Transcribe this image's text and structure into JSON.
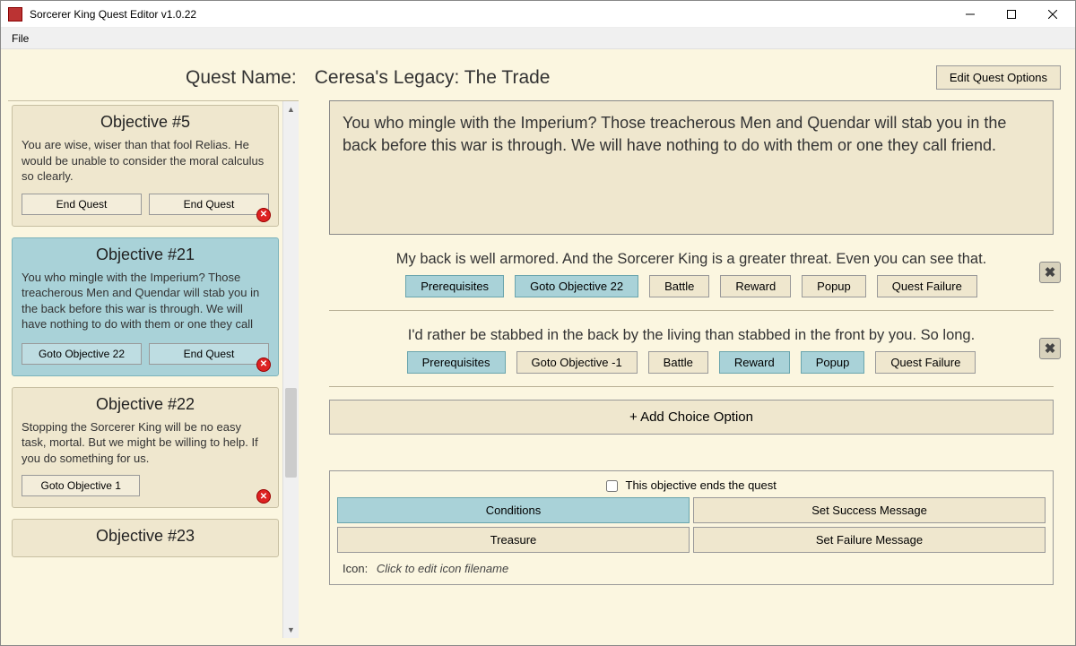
{
  "window": {
    "title": "Sorcerer King Quest Editor v1.0.22"
  },
  "menu": {
    "file": "File"
  },
  "header": {
    "quest_name_label": "Quest Name:",
    "quest_name_value": "Ceresa's Legacy: The Trade",
    "edit_options": "Edit Quest Options"
  },
  "objectives": [
    {
      "title": "Objective #5",
      "desc": "You are wise, wiser than that fool Relias. He would be unable to consider the moral calculus so clearly.",
      "buttons": [
        "End Quest",
        "End Quest"
      ],
      "selected": false
    },
    {
      "title": "Objective #21",
      "desc": "You who mingle with the Imperium? Those treacherous Men and Quendar will stab you in the back before this war is through. We will have nothing to do with them or one they call friend.",
      "buttons": [
        "Goto Objective 22",
        "End Quest"
      ],
      "selected": true
    },
    {
      "title": "Objective #22",
      "desc": "Stopping the Sorcerer King will be no easy task, mortal. But we might be willing to help. If you do something for us.",
      "buttons": [
        "Goto Objective 1"
      ],
      "selected": false
    },
    {
      "title": "Objective #23",
      "desc": "",
      "buttons": [],
      "selected": false
    }
  ],
  "detail": {
    "description": "You who mingle with the Imperium? Those treacherous Men and Quendar will stab you in the back before this war is through. We will have nothing to do with them or one they call friend.",
    "choices": [
      {
        "text": "My back is well armored. And the Sorcerer King is a greater threat. Even you can see that.",
        "buttons": [
          {
            "label": "Prerequisites",
            "on": true
          },
          {
            "label": "Goto Objective 22",
            "on": true
          },
          {
            "label": "Battle",
            "on": false
          },
          {
            "label": "Reward",
            "on": false
          },
          {
            "label": "Popup",
            "on": false
          },
          {
            "label": "Quest Failure",
            "on": false
          }
        ]
      },
      {
        "text": "I'd rather be stabbed in the back by the living than stabbed in the front by you. So long.",
        "buttons": [
          {
            "label": "Prerequisites",
            "on": true
          },
          {
            "label": "Goto Objective -1",
            "on": false
          },
          {
            "label": "Battle",
            "on": false
          },
          {
            "label": "Reward",
            "on": true
          },
          {
            "label": "Popup",
            "on": true
          },
          {
            "label": "Quest Failure",
            "on": false
          }
        ]
      }
    ],
    "add_choice": "+ Add Choice Option",
    "ends_quest_label": "This objective ends the quest",
    "ends_quest_checked": false,
    "grid": {
      "conditions": "Conditions",
      "success": "Set Success Message",
      "treasure": "Treasure",
      "failure": "Set Failure Message"
    },
    "icon_label": "Icon:",
    "icon_placeholder": "Click to edit icon filename"
  }
}
